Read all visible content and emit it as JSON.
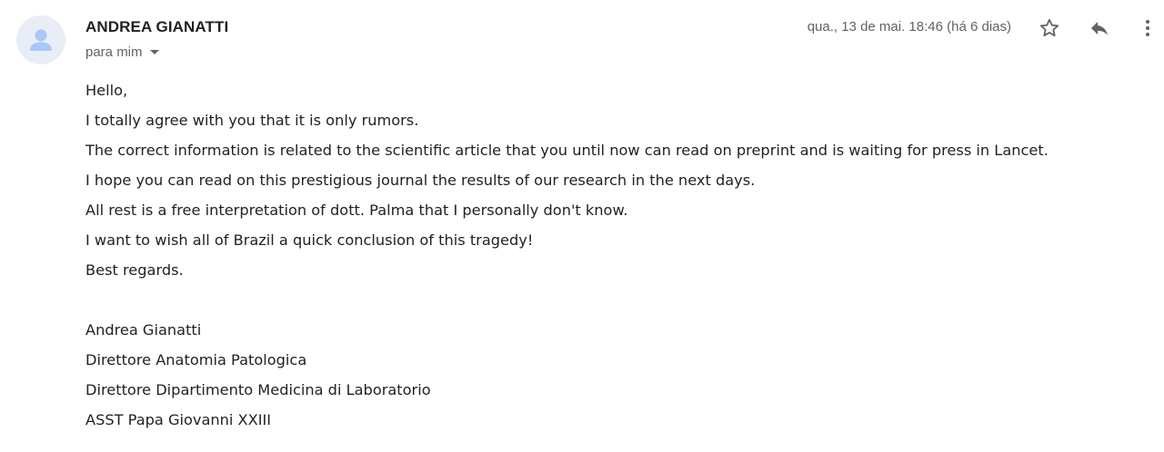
{
  "sender": {
    "name": "ANDREA GIANATTI",
    "avatar_icon": "person-icon",
    "avatar_bg": "#e9eef6",
    "avatar_fg": "#a8c7fa"
  },
  "recipient": {
    "label": "para mim",
    "dropdown_icon": "caret-down-icon"
  },
  "date": {
    "text": "qua., 13 de mai. 18:46 (há 6 dias)"
  },
  "actions": {
    "star_icon": "star-outline-icon",
    "reply_icon": "reply-icon",
    "more_icon": "more-vertical-icon"
  },
  "body": {
    "paragraph_lines": [
      "Hello,",
      "I totally agree with you that it is only rumors.",
      "The correct information is related to the scientific article that you  until now can read on preprint and is waiting for press in Lancet.",
      "I hope you can read on this prestigious journal the results of our research in the next days.",
      "All rest is a free interpretation of dott. Palma that I personally  don't know.",
      "I want to wish all of Brazil a quick conclusion of this tragedy!",
      "Best regards."
    ],
    "signature_lines": [
      "Andrea Gianatti",
      "Direttore Anatomia Patologica",
      "Direttore Dipartimento Medicina di Laboratorio",
      "ASST Papa Giovanni XXIII"
    ]
  }
}
